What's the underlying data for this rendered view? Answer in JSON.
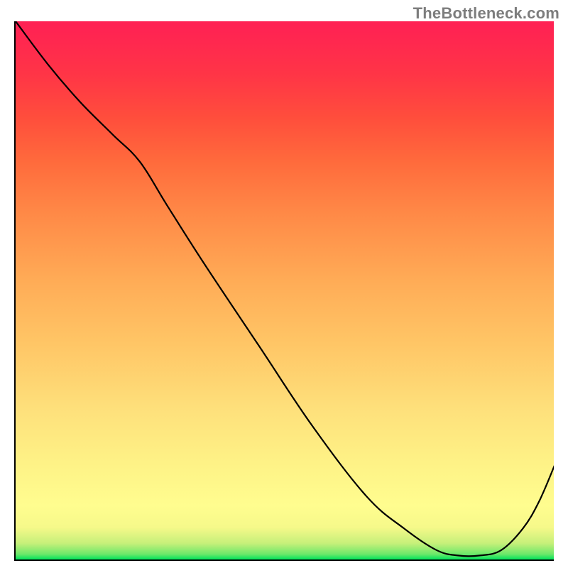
{
  "watermark": "TheBottleneck.com",
  "chart_data": {
    "type": "line",
    "title": "",
    "xlabel": "",
    "ylabel": "",
    "xlim": [
      0,
      100
    ],
    "ylim": [
      0,
      100
    ],
    "background": "red-to-green vertical heat gradient",
    "series": [
      {
        "name": "curve",
        "x": [
          0,
          6,
          12,
          18,
          23,
          28,
          35,
          45,
          55,
          65,
          72,
          78,
          82,
          86,
          90,
          94,
          97,
          100
        ],
        "y": [
          100,
          92,
          85,
          79,
          74,
          66,
          55,
          40,
          25,
          12,
          6,
          2,
          1,
          1,
          2,
          6,
          11,
          18
        ]
      }
    ],
    "annotation": {
      "text": "",
      "x": 82,
      "y": 0.5
    }
  }
}
